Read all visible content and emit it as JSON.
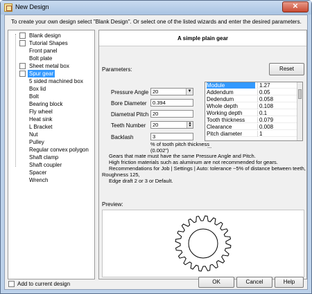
{
  "window": {
    "title": "New Design",
    "close_glyph": "✕"
  },
  "instructions": "To create your own design select \"Blank Design\". Or select one of the listed wizards and enter the desired parameters.",
  "tree": {
    "items": [
      {
        "label": "Blank design"
      },
      {
        "label": "Tutorial Shapes"
      },
      {
        "label": "Front panel"
      },
      {
        "label": "Bolt plate"
      },
      {
        "label": "Sheet metal box"
      },
      {
        "label": "Spur gear",
        "selected": true
      },
      {
        "label": "5 sided machined box"
      },
      {
        "label": "Box lid"
      },
      {
        "label": "Bolt"
      },
      {
        "label": "Bearing block"
      },
      {
        "label": "Fly wheel"
      },
      {
        "label": "Heat sink"
      },
      {
        "label": "L Bracket"
      },
      {
        "label": "Nut"
      },
      {
        "label": "Pulley"
      },
      {
        "label": "Regular convex polygon"
      },
      {
        "label": "Shaft clamp"
      },
      {
        "label": "Shaft coupler"
      },
      {
        "label": "Spacer"
      },
      {
        "label": "Wrench"
      }
    ]
  },
  "panel": {
    "title": "A simple plain gear",
    "parameters_label": "Parameters:",
    "reset_label": "Reset",
    "fields": {
      "pressure_angle": {
        "label": "Pressure Angle",
        "value": "20"
      },
      "bore_diameter": {
        "label": "Bore Diameter",
        "value": "0.394"
      },
      "diametral_pitch": {
        "label": "Diametral Pitch",
        "value": "20"
      },
      "teeth_number": {
        "label": "Teeth Number",
        "value": "20"
      },
      "backlash": {
        "label": "Backlash",
        "value": "3",
        "hint_line1": "% of tooth pitch thickness",
        "hint_line2": "(0.002\")"
      }
    },
    "properties": [
      {
        "name": "Module",
        "value": "1.27"
      },
      {
        "name": "Addendum",
        "value": "0.05"
      },
      {
        "name": "Dedendum",
        "value": "0.058"
      },
      {
        "name": "Whole depth",
        "value": "0.108"
      },
      {
        "name": "Working depth",
        "value": "0.1"
      },
      {
        "name": "Tooth thickness",
        "value": "0.079"
      },
      {
        "name": "Clearance",
        "value": "0.008"
      },
      {
        "name": "Pitch diameter",
        "value": "1"
      }
    ],
    "ellipsis": "...",
    "notes": [
      "Gears that mate must have the same Pressure Angle and Pitch.",
      "High friction materials such as aluminum are not recommended for gears.",
      "Recommendations for Job | Settings | Auto: tolerance ~5% of distance between teeth,",
      "Roughness 125,",
      "Edge draft  2 or 3 or Default."
    ],
    "preview_label": "Preview:"
  },
  "footer": {
    "add_to_current_label": "Add to current design",
    "ok_label": "OK",
    "cancel_label": "Cancel",
    "help_label": "Help"
  }
}
